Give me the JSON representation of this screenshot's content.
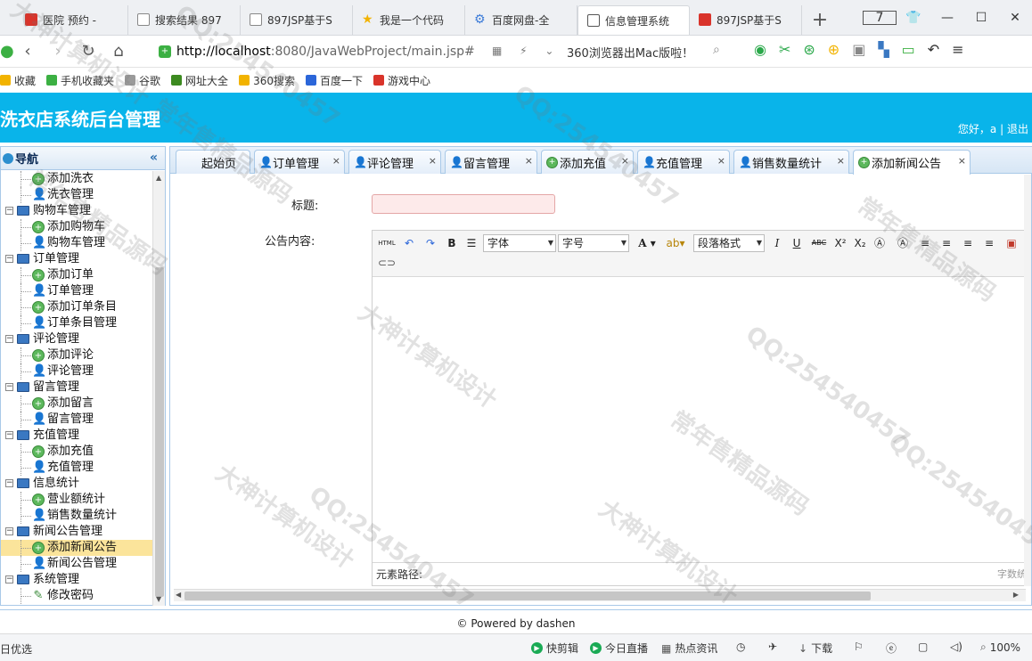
{
  "browser": {
    "tabs": [
      {
        "label": "医院 预约 -",
        "icon": "red"
      },
      {
        "label": "搜索结果 897",
        "icon": "doc"
      },
      {
        "label": "897JSP基于S",
        "icon": "doc"
      },
      {
        "label": "我是一个代码",
        "icon": "star"
      },
      {
        "label": "百度网盘-全",
        "icon": "pan"
      },
      {
        "label": "信息管理系统",
        "icon": "chart",
        "active": true
      },
      {
        "label": "897JSP基于S",
        "icon": "red"
      }
    ],
    "new_tab": "+",
    "tab_count": "7",
    "address": {
      "host": "http://localhost",
      "rest": ":8080/JavaWebProject/main.jsp#"
    },
    "promo": "360浏览器出Mac版啦！",
    "bookmarks": [
      {
        "label": "收藏",
        "color": "#f2b300"
      },
      {
        "label": "手机收藏夹",
        "color": "#3cb043"
      },
      {
        "label": "谷歌",
        "color": "#9a9a9a"
      },
      {
        "label": "网址大全",
        "color": "#3c8a20"
      },
      {
        "label": "360搜索",
        "color": "#f2b300"
      },
      {
        "label": "百度一下",
        "color": "#2b66d9"
      },
      {
        "label": "游戏中心",
        "color": "#d9342b"
      }
    ]
  },
  "app": {
    "title": "洗衣店系统后台管理",
    "greeting": "您好，a",
    "separator": "|",
    "logout": "退出",
    "accent": "#09b4ea"
  },
  "sidebar": {
    "title": "导航",
    "collapse": "«",
    "tree": [
      {
        "label": "添加洗衣",
        "type": "leaf",
        "icon": "add"
      },
      {
        "label": "洗衣管理",
        "type": "leaf",
        "icon": "user"
      },
      {
        "label": "购物车管理",
        "type": "group"
      },
      {
        "label": "添加购物车",
        "type": "leaf",
        "icon": "add"
      },
      {
        "label": "购物车管理",
        "type": "leaf",
        "icon": "user"
      },
      {
        "label": "订单管理",
        "type": "group"
      },
      {
        "label": "添加订单",
        "type": "leaf",
        "icon": "add"
      },
      {
        "label": "订单管理",
        "type": "leaf",
        "icon": "user"
      },
      {
        "label": "添加订单条目",
        "type": "leaf",
        "icon": "add"
      },
      {
        "label": "订单条目管理",
        "type": "leaf",
        "icon": "user"
      },
      {
        "label": "评论管理",
        "type": "group"
      },
      {
        "label": "添加评论",
        "type": "leaf",
        "icon": "add"
      },
      {
        "label": "评论管理",
        "type": "leaf",
        "icon": "user"
      },
      {
        "label": "留言管理",
        "type": "group"
      },
      {
        "label": "添加留言",
        "type": "leaf",
        "icon": "add"
      },
      {
        "label": "留言管理",
        "type": "leaf",
        "icon": "user"
      },
      {
        "label": "充值管理",
        "type": "group"
      },
      {
        "label": "添加充值",
        "type": "leaf",
        "icon": "add"
      },
      {
        "label": "充值管理",
        "type": "leaf",
        "icon": "user"
      },
      {
        "label": "信息统计",
        "type": "group"
      },
      {
        "label": "营业额统计",
        "type": "leaf",
        "icon": "add"
      },
      {
        "label": "销售数量统计",
        "type": "leaf",
        "icon": "user"
      },
      {
        "label": "新闻公告管理",
        "type": "group"
      },
      {
        "label": "添加新闻公告",
        "type": "leaf",
        "icon": "add",
        "selected": true
      },
      {
        "label": "新闻公告管理",
        "type": "leaf",
        "icon": "user"
      },
      {
        "label": "系统管理",
        "type": "group"
      },
      {
        "label": "修改密码",
        "type": "leaf",
        "icon": "pen"
      }
    ]
  },
  "tabs": [
    {
      "label": "起始页",
      "home": true
    },
    {
      "label": "订单管理",
      "icon": "user",
      "close": "×"
    },
    {
      "label": "评论管理",
      "icon": "user",
      "close": "×"
    },
    {
      "label": "留言管理",
      "icon": "user",
      "close": "×"
    },
    {
      "label": "添加充值",
      "icon": "add",
      "close": "×"
    },
    {
      "label": "充值管理",
      "icon": "user",
      "close": "×"
    },
    {
      "label": "销售数量统计",
      "icon": "user",
      "close": "×"
    },
    {
      "label": "添加新闻公告",
      "icon": "add",
      "close": "×",
      "active": true
    }
  ],
  "form": {
    "title_label": "标题:",
    "content_label": "公告内容:",
    "title_value": ""
  },
  "editor": {
    "html_btn": "HTML",
    "bold": "B",
    "font_family": "字体",
    "font_size": "字号",
    "font_color": "A",
    "paragraph": "段落格式",
    "italic": "I",
    "underline": "U",
    "strike": "ABC",
    "sup": "X²",
    "sub": "X₂",
    "path_label": "元素路径:",
    "word_count": "字数统"
  },
  "footer": {
    "text": "© Powered by dashen"
  },
  "statusbar": {
    "left": "日优选",
    "items": [
      "快剪辑",
      "今日直播",
      "热点资讯",
      "下载"
    ],
    "zoom": "100%"
  },
  "watermark": [
    "大神计算机设计",
    "QQ:254540457",
    "常年售精品源码"
  ]
}
